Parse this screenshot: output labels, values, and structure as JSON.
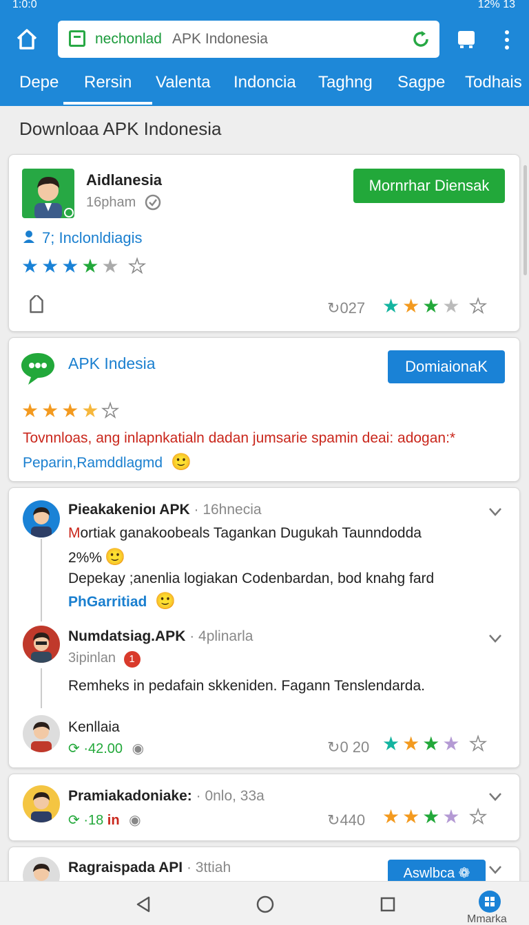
{
  "status": {
    "left": "1:0:0",
    "right": "12% 13"
  },
  "browser": {
    "url_host": "nechonlad",
    "url_rest": "APK Indonesia",
    "tabs": [
      "Depe",
      "Rersin",
      "Valenta",
      "Indoncia",
      "Taghng",
      "Sagpe",
      "Todhais"
    ]
  },
  "page": {
    "title": "Downloaa APK Indonesia"
  },
  "app1": {
    "name": "Aidlanesia",
    "sub": "16pham",
    "users": "7; Inclonldiagis",
    "button": "Mornrhar Diensak",
    "count": "027",
    "rating": 4
  },
  "app2": {
    "name": "APK Indesia",
    "button": "DomiaionaK",
    "rating": 3.5,
    "desc": "Tovnnloas, ang inlapnkatialn dadan jumsarie spamin deai: adogan:*",
    "link": "Peparin,Ramddlagmd"
  },
  "comments": [
    {
      "author": "Pieakakenioı APK",
      "meta": "16hnecia",
      "text1_red": "M",
      "text1": "ortiak ganakoobeals Tagankan Dugukah Taunndodda",
      "sub1": "2%%",
      "text2": "Depekay ;anenlia logiakan Codenbardan, bod knahg fard",
      "link": "PhGarritiad"
    },
    {
      "author": "Numdatsiag.APK",
      "meta": "4plinarla",
      "sub": "3ipinlan",
      "badge": "1",
      "text": "Remheks in pedafain skkeniden. Fagann Tenslendarda."
    },
    {
      "author": "Kenllaia",
      "stat": "·42.00",
      "count": "0 20"
    }
  ],
  "review1": {
    "author": "Pramiakadoniake:",
    "meta": "0nlo, 33a",
    "stat": "·18",
    "stat_red": "in",
    "count": "440"
  },
  "review2": {
    "author": "Ragraispada API",
    "meta": "3ttiah",
    "button": "Aswlbca",
    "button_icon": "❁"
  },
  "bottom": {
    "label": "Mmarka"
  },
  "colors": {
    "brand": "#1e88d8",
    "green": "#22a83a",
    "star_blue": "#1a82d6",
    "star_orange": "#f39a1f"
  }
}
